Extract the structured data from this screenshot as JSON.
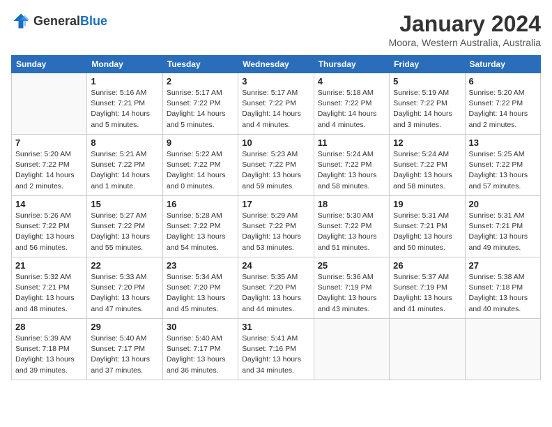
{
  "logo": {
    "text_general": "General",
    "text_blue": "Blue"
  },
  "header": {
    "month_title": "January 2024",
    "location": "Moora, Western Australia, Australia"
  },
  "weekdays": [
    "Sunday",
    "Monday",
    "Tuesday",
    "Wednesday",
    "Thursday",
    "Friday",
    "Saturday"
  ],
  "weeks": [
    [
      {
        "date": "",
        "info": ""
      },
      {
        "date": "1",
        "info": "Sunrise: 5:16 AM\nSunset: 7:21 PM\nDaylight: 14 hours\nand 5 minutes."
      },
      {
        "date": "2",
        "info": "Sunrise: 5:17 AM\nSunset: 7:22 PM\nDaylight: 14 hours\nand 5 minutes."
      },
      {
        "date": "3",
        "info": "Sunrise: 5:17 AM\nSunset: 7:22 PM\nDaylight: 14 hours\nand 4 minutes."
      },
      {
        "date": "4",
        "info": "Sunrise: 5:18 AM\nSunset: 7:22 PM\nDaylight: 14 hours\nand 4 minutes."
      },
      {
        "date": "5",
        "info": "Sunrise: 5:19 AM\nSunset: 7:22 PM\nDaylight: 14 hours\nand 3 minutes."
      },
      {
        "date": "6",
        "info": "Sunrise: 5:20 AM\nSunset: 7:22 PM\nDaylight: 14 hours\nand 2 minutes."
      }
    ],
    [
      {
        "date": "7",
        "info": "Sunrise: 5:20 AM\nSunset: 7:22 PM\nDaylight: 14 hours\nand 2 minutes."
      },
      {
        "date": "8",
        "info": "Sunrise: 5:21 AM\nSunset: 7:22 PM\nDaylight: 14 hours\nand 1 minute."
      },
      {
        "date": "9",
        "info": "Sunrise: 5:22 AM\nSunset: 7:22 PM\nDaylight: 14 hours\nand 0 minutes."
      },
      {
        "date": "10",
        "info": "Sunrise: 5:23 AM\nSunset: 7:22 PM\nDaylight: 13 hours\nand 59 minutes."
      },
      {
        "date": "11",
        "info": "Sunrise: 5:24 AM\nSunset: 7:22 PM\nDaylight: 13 hours\nand 58 minutes."
      },
      {
        "date": "12",
        "info": "Sunrise: 5:24 AM\nSunset: 7:22 PM\nDaylight: 13 hours\nand 58 minutes."
      },
      {
        "date": "13",
        "info": "Sunrise: 5:25 AM\nSunset: 7:22 PM\nDaylight: 13 hours\nand 57 minutes."
      }
    ],
    [
      {
        "date": "14",
        "info": "Sunrise: 5:26 AM\nSunset: 7:22 PM\nDaylight: 13 hours\nand 56 minutes."
      },
      {
        "date": "15",
        "info": "Sunrise: 5:27 AM\nSunset: 7:22 PM\nDaylight: 13 hours\nand 55 minutes."
      },
      {
        "date": "16",
        "info": "Sunrise: 5:28 AM\nSunset: 7:22 PM\nDaylight: 13 hours\nand 54 minutes."
      },
      {
        "date": "17",
        "info": "Sunrise: 5:29 AM\nSunset: 7:22 PM\nDaylight: 13 hours\nand 53 minutes."
      },
      {
        "date": "18",
        "info": "Sunrise: 5:30 AM\nSunset: 7:22 PM\nDaylight: 13 hours\nand 51 minutes."
      },
      {
        "date": "19",
        "info": "Sunrise: 5:31 AM\nSunset: 7:21 PM\nDaylight: 13 hours\nand 50 minutes."
      },
      {
        "date": "20",
        "info": "Sunrise: 5:31 AM\nSunset: 7:21 PM\nDaylight: 13 hours\nand 49 minutes."
      }
    ],
    [
      {
        "date": "21",
        "info": "Sunrise: 5:32 AM\nSunset: 7:21 PM\nDaylight: 13 hours\nand 48 minutes."
      },
      {
        "date": "22",
        "info": "Sunrise: 5:33 AM\nSunset: 7:20 PM\nDaylight: 13 hours\nand 47 minutes."
      },
      {
        "date": "23",
        "info": "Sunrise: 5:34 AM\nSunset: 7:20 PM\nDaylight: 13 hours\nand 45 minutes."
      },
      {
        "date": "24",
        "info": "Sunrise: 5:35 AM\nSunset: 7:20 PM\nDaylight: 13 hours\nand 44 minutes."
      },
      {
        "date": "25",
        "info": "Sunrise: 5:36 AM\nSunset: 7:19 PM\nDaylight: 13 hours\nand 43 minutes."
      },
      {
        "date": "26",
        "info": "Sunrise: 5:37 AM\nSunset: 7:19 PM\nDaylight: 13 hours\nand 41 minutes."
      },
      {
        "date": "27",
        "info": "Sunrise: 5:38 AM\nSunset: 7:18 PM\nDaylight: 13 hours\nand 40 minutes."
      }
    ],
    [
      {
        "date": "28",
        "info": "Sunrise: 5:39 AM\nSunset: 7:18 PM\nDaylight: 13 hours\nand 39 minutes."
      },
      {
        "date": "29",
        "info": "Sunrise: 5:40 AM\nSunset: 7:17 PM\nDaylight: 13 hours\nand 37 minutes."
      },
      {
        "date": "30",
        "info": "Sunrise: 5:40 AM\nSunset: 7:17 PM\nDaylight: 13 hours\nand 36 minutes."
      },
      {
        "date": "31",
        "info": "Sunrise: 5:41 AM\nSunset: 7:16 PM\nDaylight: 13 hours\nand 34 minutes."
      },
      {
        "date": "",
        "info": ""
      },
      {
        "date": "",
        "info": ""
      },
      {
        "date": "",
        "info": ""
      }
    ]
  ]
}
